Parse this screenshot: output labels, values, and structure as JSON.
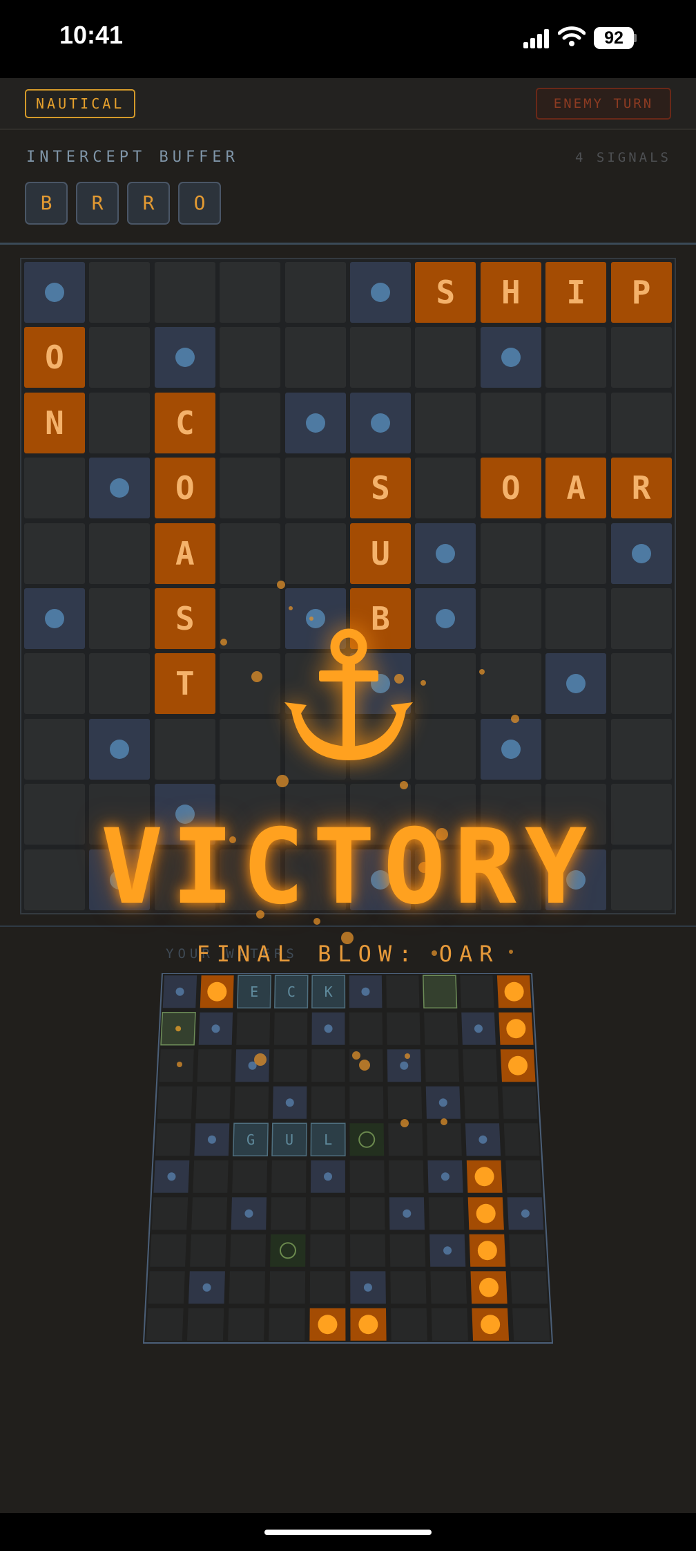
{
  "status_bar": {
    "time": "10:41",
    "battery": "92"
  },
  "header": {
    "theme_badge": "NAUTICAL",
    "turn_badge": "ENEMY TURN"
  },
  "buffer": {
    "label": "INTERCEPT BUFFER",
    "signal_count": "4 SIGNALS",
    "letters": [
      "B",
      "R",
      "R",
      "O"
    ]
  },
  "enemy_board": {
    "rows": [
      [
        "m",
        "e",
        "e",
        "e",
        "e",
        "m",
        "S",
        "H",
        "I",
        "P"
      ],
      [
        "O",
        "e",
        "m",
        "e",
        "e",
        "e",
        "e",
        "m",
        "e",
        "e"
      ],
      [
        "N",
        "e",
        "C",
        "e",
        "m",
        "m",
        "e",
        "e",
        "e",
        "e"
      ],
      [
        "e",
        "m",
        "O",
        "e",
        "e",
        "S",
        "e",
        "O",
        "A",
        "R"
      ],
      [
        "e",
        "e",
        "A",
        "e",
        "e",
        "U",
        "m",
        "e",
        "e",
        "m"
      ],
      [
        "m",
        "e",
        "S",
        "e",
        "m",
        "B",
        "m",
        "e",
        "e",
        "e"
      ],
      [
        "e",
        "e",
        "T",
        "e",
        "e",
        "m",
        "e",
        "e",
        "m",
        "e"
      ],
      [
        "e",
        "m",
        "e",
        "e",
        "e",
        "e",
        "e",
        "m",
        "e",
        "e"
      ],
      [
        "e",
        "e",
        "m",
        "e",
        "e",
        "e",
        "e",
        "e",
        "e",
        "e"
      ],
      [
        "e",
        "m",
        "e",
        "e",
        "e",
        "m",
        "e",
        "e",
        "m",
        "e"
      ]
    ]
  },
  "own_board": {
    "label": "YOUR WATERS",
    "rows": [
      [
        "m",
        "h",
        "E",
        "C",
        "K",
        "m",
        "e",
        "g",
        "e",
        "h"
      ],
      [
        "gd",
        "m",
        "e",
        "e",
        "m",
        "e",
        "e",
        "e",
        "m",
        "h"
      ],
      [
        "e",
        "e",
        "m",
        "e",
        "e",
        "e",
        "m",
        "e",
        "e",
        "h"
      ],
      [
        "e",
        "e",
        "e",
        "m",
        "e",
        "e",
        "e",
        "m",
        "e",
        "e"
      ],
      [
        "e",
        "m",
        "G",
        "U",
        "L",
        "r",
        "e",
        "e",
        "m",
        "e"
      ],
      [
        "m",
        "e",
        "e",
        "e",
        "m",
        "e",
        "e",
        "m",
        "h",
        "e"
      ],
      [
        "e",
        "e",
        "m",
        "e",
        "e",
        "e",
        "m",
        "e",
        "h",
        "m"
      ],
      [
        "e",
        "e",
        "e",
        "r",
        "e",
        "e",
        "e",
        "m",
        "h",
        "e"
      ],
      [
        "e",
        "m",
        "e",
        "e",
        "e",
        "m",
        "e",
        "e",
        "h",
        "e"
      ],
      [
        "e",
        "e",
        "e",
        "e",
        "h",
        "h",
        "e",
        "e",
        "h",
        "e"
      ]
    ]
  },
  "result": {
    "title": "VICTORY",
    "final_blow": "FINAL BLOW: OAR"
  },
  "icons": {
    "victory": "anchor-icon",
    "cellular": "signal-icon",
    "wifi": "wifi-icon",
    "battery": "battery-icon"
  },
  "colors": {
    "accent": "#ffa11f",
    "hit": "#a44c03",
    "miss": "#313a4d",
    "miss_dot": "#4e7aa2",
    "buffer_text": "#e39a32"
  }
}
